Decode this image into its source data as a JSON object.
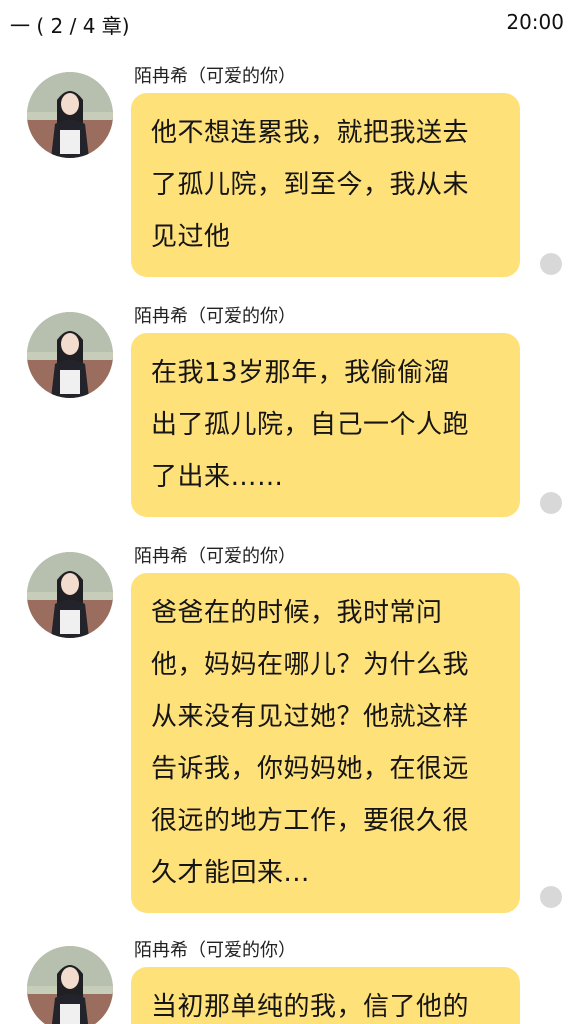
{
  "status": {
    "chapter": "一 ( 2 / 4 章)",
    "time": "20:00"
  },
  "messages": [
    {
      "sender": "陌冉希（可爱的你）",
      "lines": [
        "他不想连累我，就把我送去",
        "了孤儿院，到至今，我从未",
        "见过他"
      ]
    },
    {
      "sender": "陌冉希（可爱的你）",
      "lines": [
        "在我13岁那年，我偷偷溜",
        "出了孤儿院，自己一个人跑",
        "了出来……"
      ]
    },
    {
      "sender": "陌冉希（可爱的你）",
      "lines": [
        "爸爸在的时候，我时常问",
        "他，妈妈在哪儿？为什么我",
        "从来没有见过她？他就这样",
        "告诉我，你妈妈她，在很远",
        "很远的地方工作，要很久很",
        "久才能回来..."
      ]
    },
    {
      "sender": "陌冉希（可爱的你）",
      "lines": [
        "当初那单纯的我，信了他的"
      ]
    }
  ],
  "colors": {
    "bubble": "#ffe17a",
    "dot": "#d8d8d8"
  }
}
